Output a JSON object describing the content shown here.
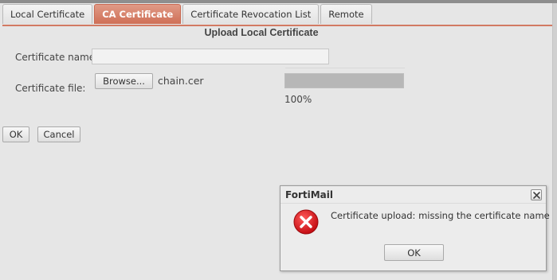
{
  "tabs": [
    {
      "label": "Local Certificate",
      "active": false
    },
    {
      "label": "CA Certificate",
      "active": true
    },
    {
      "label": "Certificate Revocation List",
      "active": false
    },
    {
      "label": "Remote",
      "active": false
    }
  ],
  "section": {
    "title": "Upload Local Certificate"
  },
  "form": {
    "name_label": "Certificate name:",
    "name_value": "",
    "file_label": "Certificate file:",
    "browse_label": "Browse...",
    "file_name": "chain.cer",
    "progress_fraction": 1.0,
    "progress_text": "100%"
  },
  "actions": {
    "ok_label": "OK",
    "cancel_label": "Cancel"
  },
  "dialog": {
    "title": "FortiMail",
    "message": "Certificate upload: missing the certificate name",
    "ok_label": "OK",
    "icon": "error-icon"
  },
  "colors": {
    "active_tab": "#d27a63",
    "error_red": "#d9161c"
  }
}
